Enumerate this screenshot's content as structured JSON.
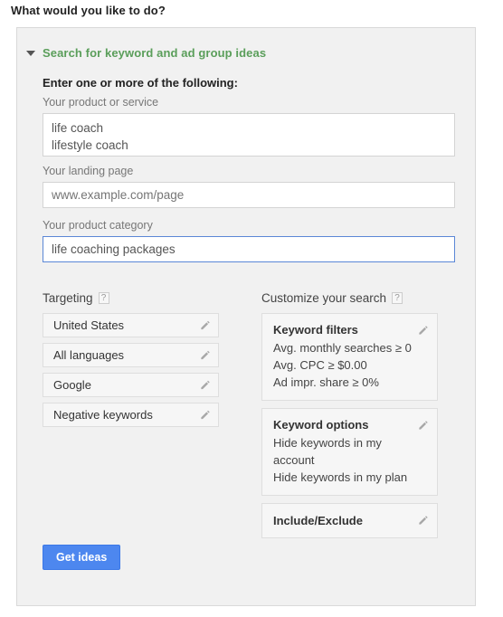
{
  "page": {
    "heading": "What would you like to do?"
  },
  "section": {
    "title": "Search for keyword and ad group ideas",
    "toggle_icon": "chevron-down-icon",
    "enter_label": "Enter one or more of the following:"
  },
  "fields": {
    "product_or_service": {
      "label": "Your product or service",
      "value": "life coach\nlifestyle coach",
      "placeholder": ""
    },
    "landing_page": {
      "label": "Your landing page",
      "value": "",
      "placeholder": "www.example.com/page"
    },
    "product_category": {
      "label": "Your product category",
      "value": "life coaching packages",
      "placeholder": "",
      "focused": true
    }
  },
  "targeting": {
    "label": "Targeting",
    "help_icon": "question-mark-icon",
    "rows": [
      {
        "label": "United States",
        "edit_icon": "pencil-icon"
      },
      {
        "label": "All languages",
        "edit_icon": "pencil-icon"
      },
      {
        "label": "Google",
        "edit_icon": "pencil-icon"
      },
      {
        "label": "Negative keywords",
        "edit_icon": "pencil-icon"
      }
    ]
  },
  "customize": {
    "label": "Customize your search",
    "help_icon": "question-mark-icon",
    "boxes": [
      {
        "title": "Keyword filters",
        "edit_icon": "pencil-icon",
        "lines": [
          "Avg. monthly searches ≥ 0",
          "Avg. CPC ≥ $0.00",
          "Ad impr. share ≥ 0%"
        ]
      },
      {
        "title": "Keyword options",
        "edit_icon": "pencil-icon",
        "lines": [
          "Hide keywords in my account",
          "Hide keywords in my plan"
        ]
      },
      {
        "title": "Include/Exclude",
        "edit_icon": "pencil-icon",
        "lines": []
      }
    ]
  },
  "actions": {
    "get_ideas_label": "Get ideas"
  },
  "colors": {
    "accent_green": "#5a9e5a",
    "primary_blue": "#4d87ef",
    "focus_border": "#5b87d6",
    "panel_bg": "#f1f1f1",
    "box_bg": "#f6f6f6",
    "icon_gray": "#aaaaaa"
  }
}
